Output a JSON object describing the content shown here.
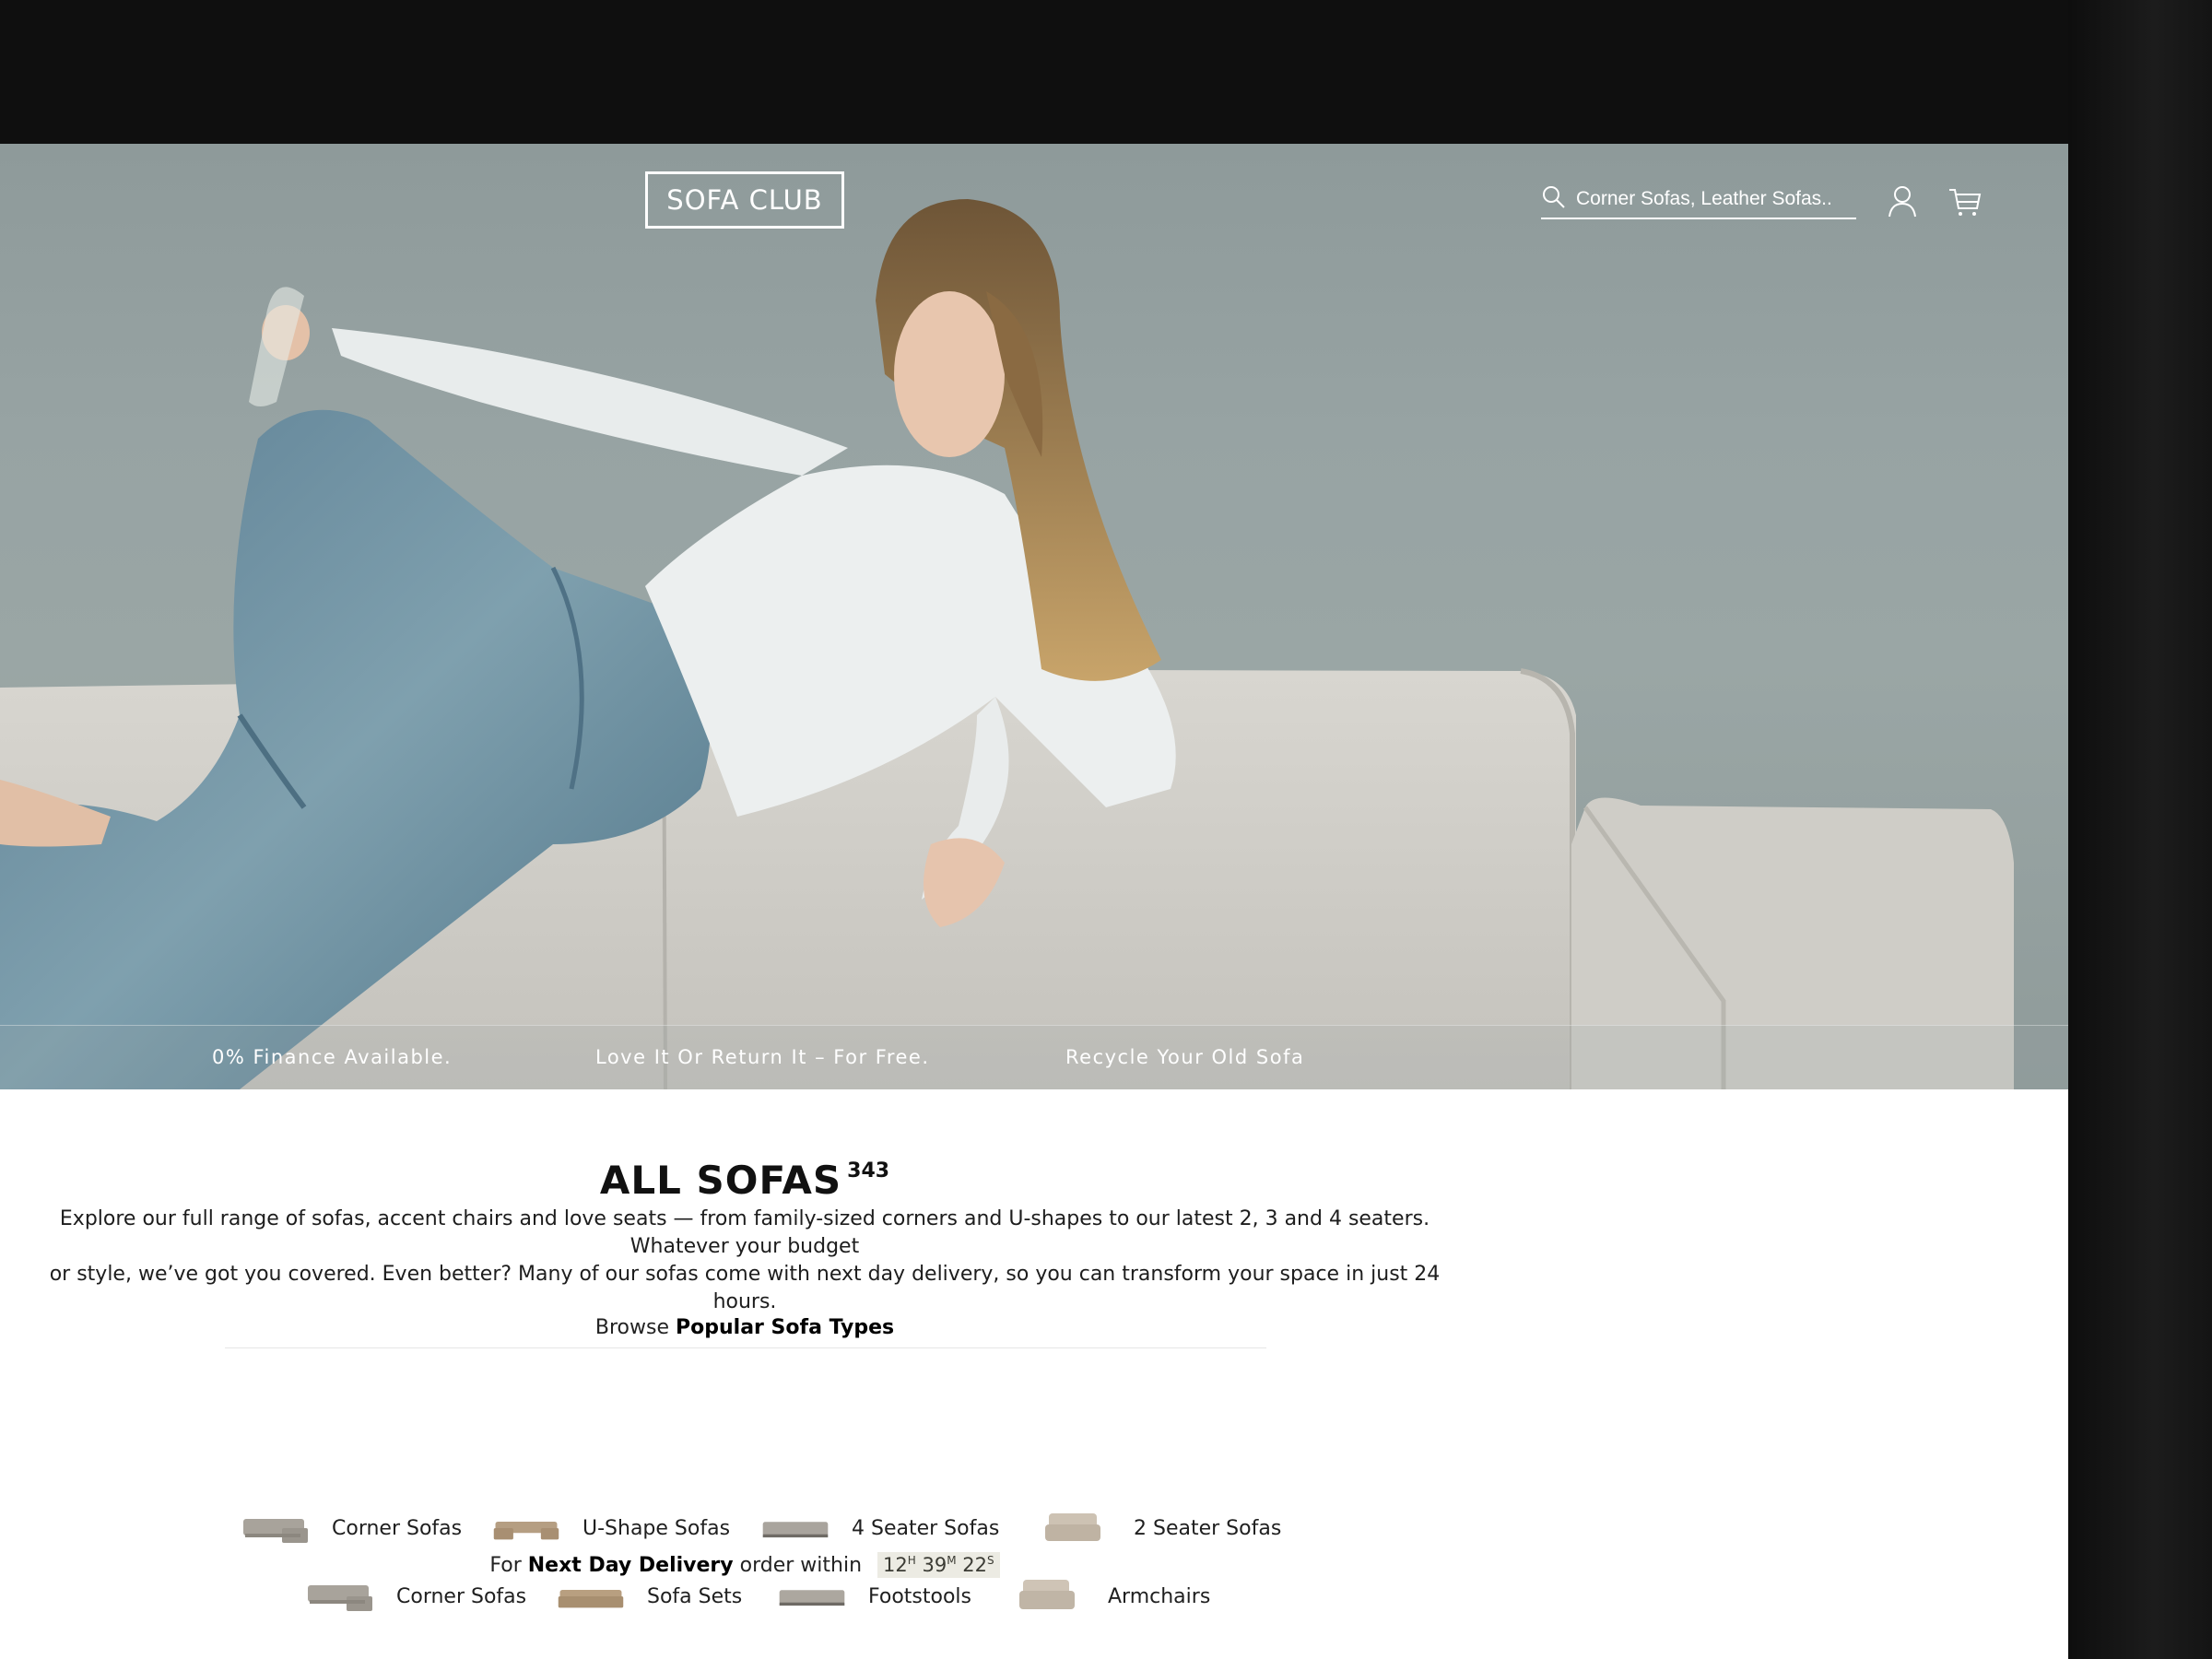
{
  "brand": {
    "logo_text": "SOFA CLUB"
  },
  "header": {
    "search_placeholder": "Corner Sofas, Leather Sofas.."
  },
  "usp": [
    "0% Finance Available.",
    "Love It Or Return It – For Free.",
    "Recycle Your Old Sofa"
  ],
  "category": {
    "title": "ALL SOFAS",
    "count": "343",
    "description_line1": "Explore our full range of sofas, accent chairs and love seats — from family-sized corners and U-shapes to our latest 2, 3 and 4 seaters. Whatever your budget",
    "description_line2": "or style, we’ve got you covered. Even better? Many of our sofas come with next day delivery, so you can transform your space in just 24 hours."
  },
  "browse": {
    "prefix": "Browse",
    "emphasis": "Popular Sofa Types",
    "types": [
      {
        "label": "Corner Sofas",
        "icon": "corner-sofa-thumb"
      },
      {
        "label": "U-Shape Sofas",
        "icon": "u-shape-sofa-thumb"
      },
      {
        "label": "4 Seater Sofas",
        "icon": "four-seater-sofa-thumb"
      },
      {
        "label": "2 Seater Sofas",
        "icon": "two-seater-sofa-thumb"
      },
      {
        "label": "Corner Sofas",
        "icon": "corner-sofa-thumb"
      },
      {
        "label": "Sofa Sets",
        "icon": "sofa-set-thumb"
      },
      {
        "label": "Footstools",
        "icon": "footstool-thumb"
      },
      {
        "label": "Armchairs",
        "icon": "armchair-thumb"
      }
    ]
  },
  "delivery": {
    "prefix": "For",
    "emphasis": "Next Day Delivery",
    "suffix": "order within",
    "hours": "12",
    "hours_unit": "H",
    "minutes": "39",
    "minutes_unit": "M",
    "seconds": "22",
    "seconds_unit": "S"
  },
  "colors": {
    "hero_bg": "#97a3a3",
    "text_dark": "#111111",
    "timer_bg": "#ecebe3"
  }
}
